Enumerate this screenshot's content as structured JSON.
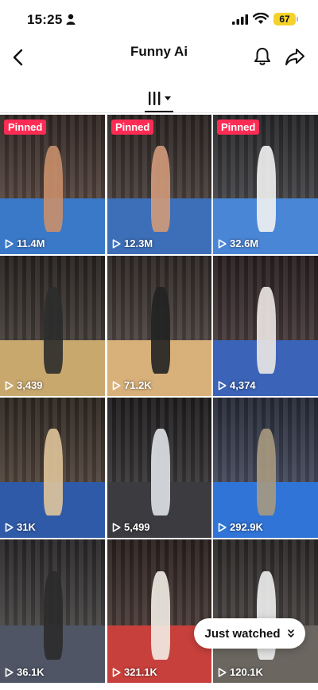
{
  "status_bar": {
    "time": "15:25",
    "battery": "67"
  },
  "header": {
    "title": "Funny Ai"
  },
  "grid": {
    "videos": [
      {
        "views": "11.4M",
        "pinned": "Pinned",
        "crowd": "#4a3a34",
        "floor": "#3a78c8",
        "fig": "#c98f6a"
      },
      {
        "views": "12.3M",
        "pinned": "Pinned",
        "crowd": "#3f3532",
        "floor": "#3d6fb8",
        "fig": "#d19a7a"
      },
      {
        "views": "32.6M",
        "pinned": "Pinned",
        "crowd": "#3a3a3e",
        "floor": "#4a86d6",
        "fig": "#f2f2f2"
      },
      {
        "views": "3,439",
        "pinned": "",
        "crowd": "#3a332f",
        "floor": "#c9a86e",
        "fig": "#2c2c2c"
      },
      {
        "views": "71.2K",
        "pinned": "",
        "crowd": "#433a36",
        "floor": "#d8b07a",
        "fig": "#222"
      },
      {
        "views": "4,374",
        "pinned": "",
        "crowd": "#3b2e30",
        "floor": "#3b63b8",
        "fig": "#ece8e4"
      },
      {
        "views": "31K",
        "pinned": "",
        "crowd": "#463a31",
        "floor": "#2f5aa8",
        "fig": "#e0c49a"
      },
      {
        "views": "5,499",
        "pinned": "",
        "crowd": "#2e2b2d",
        "floor": "#3b3b40",
        "fig": "#dfe3e8"
      },
      {
        "views": "292.9K",
        "pinned": "",
        "crowd": "#3a3f52",
        "floor": "#2f74d6",
        "fig": "#a89a80"
      },
      {
        "views": "36.1K",
        "pinned": "",
        "crowd": "#3d3a3a",
        "floor": "#4f5565",
        "fig": "#2b2b2b"
      },
      {
        "views": "321.1K",
        "pinned": "",
        "crowd": "#3f302c",
        "floor": "#c8403c",
        "fig": "#f1ece4"
      },
      {
        "views": "120.1K",
        "pinned": "",
        "crowd": "#3e3a38",
        "floor": "#6b6660",
        "fig": "#efefef"
      }
    ]
  },
  "just_watched": {
    "label": "Just watched"
  }
}
